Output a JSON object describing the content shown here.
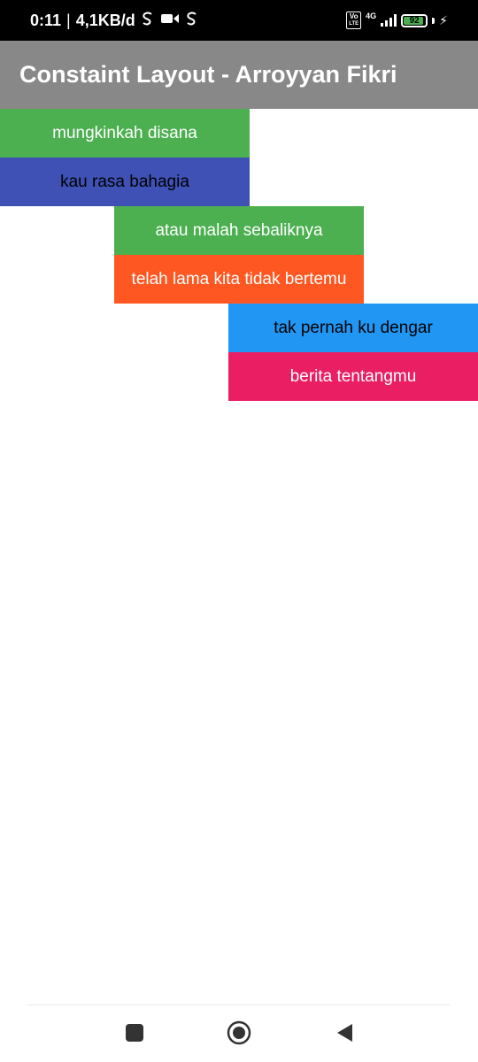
{
  "status_bar": {
    "time": "0:11",
    "separator": "|",
    "speed": "4,1KB/d",
    "volte_top": "Vo",
    "volte_bottom": "LTE",
    "network": "4G",
    "battery_level": "92",
    "battery_fraction": 0.92
  },
  "app_bar": {
    "title": "Constaint Layout - Arroyyan Fikri"
  },
  "blocks": [
    {
      "label": "mungkinkah disana",
      "bg": "#4caf50",
      "color": "#ffffff"
    },
    {
      "label": "kau rasa bahagia",
      "bg": "#3f51b5",
      "color": "#000000"
    },
    {
      "label": "atau malah sebaliknya",
      "bg": "#4caf50",
      "color": "#ffffff"
    },
    {
      "label": "telah lama kita tidak bertemu",
      "bg": "#ff5722",
      "color": "#ffffff"
    },
    {
      "label": "tak pernah ku dengar",
      "bg": "#2196f3",
      "color": "#000000"
    },
    {
      "label": "berita tentangmu",
      "bg": "#e91e63",
      "color": "#ffffff"
    }
  ],
  "nav_bar": {
    "recents_icon": "square-icon",
    "home_icon": "circle-icon",
    "back_icon": "triangle-back-icon"
  }
}
